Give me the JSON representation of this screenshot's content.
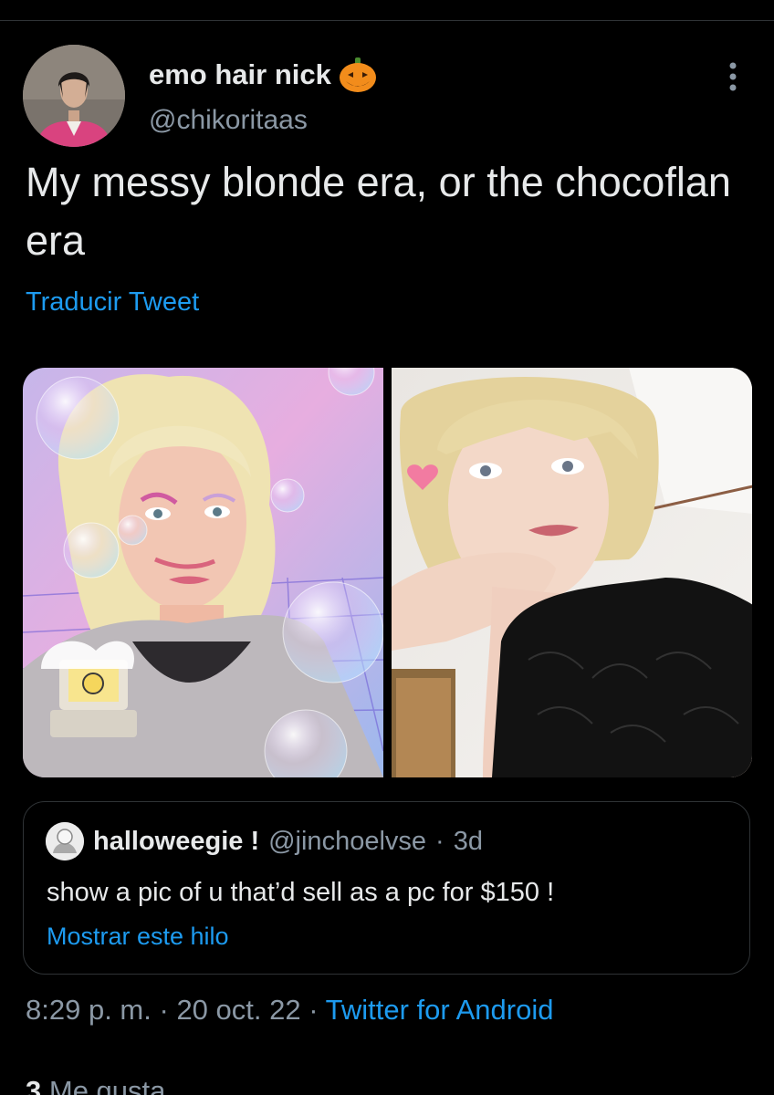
{
  "author": {
    "display_name": "emo hair nick",
    "handle": "@chikoritaas",
    "badge_emoji": "jack-o-lantern-icon"
  },
  "tweet": {
    "text": "My messy blonde era, or the chocoflan era",
    "translate_label": "Traducir Tweet"
  },
  "quote": {
    "display_name": "halloweegie !",
    "handle": "@jinchoelvse",
    "separator": "·",
    "age": "3d",
    "text": "show a pic of u that’d sell as a pc for $150 !",
    "show_thread_label": "Mostrar este hilo"
  },
  "meta": {
    "time": "8:29 p. m.",
    "date": "20 oct. 22",
    "dot1": "·",
    "dot2": "·",
    "source": "Twitter for Android"
  },
  "engagement": {
    "likes_count": "3",
    "likes_label": "Me gusta"
  },
  "colors": {
    "background": "#000000",
    "primary_text": "#e7e9ea",
    "secondary_text": "#8b98a5",
    "link": "#1d9bf0",
    "border": "#2f3336"
  }
}
